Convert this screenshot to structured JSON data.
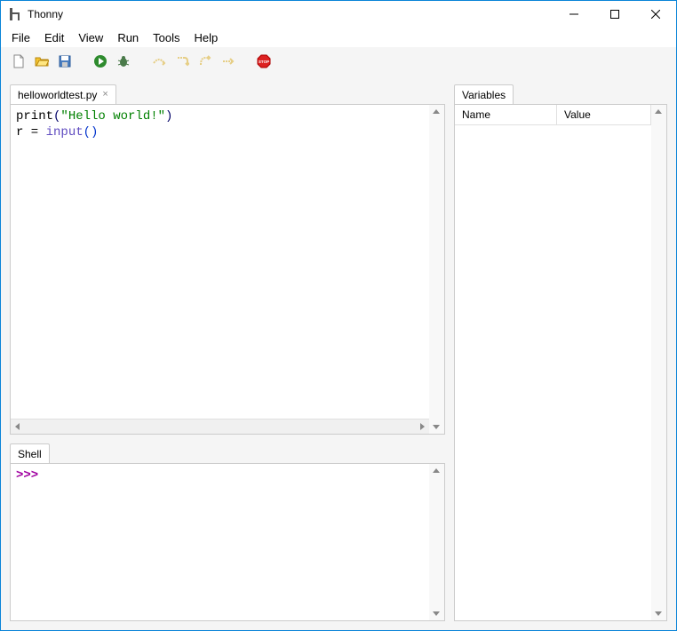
{
  "window": {
    "title": "Thonny"
  },
  "menubar": {
    "items": [
      "File",
      "Edit",
      "View",
      "Run",
      "Tools",
      "Help"
    ]
  },
  "toolbar": {
    "icons": [
      "new-file",
      "open-file",
      "save-file",
      "run",
      "debug",
      "step-over",
      "step-into",
      "step-out",
      "resume",
      "stop"
    ]
  },
  "editor": {
    "tab_label": "helloworldtest.py",
    "code": {
      "line1": {
        "func": "print",
        "lparen": "(",
        "str": "\"Hello world!\"",
        "rparen": ")"
      },
      "line2": {
        "var": "r",
        "eq": " = ",
        "builtin": "input",
        "lparen": "(",
        "rparen": ")"
      }
    }
  },
  "shell": {
    "tab_label": "Shell",
    "prompt": ">>> "
  },
  "variables": {
    "tab_label": "Variables",
    "col_name": "Name",
    "col_value": "Value"
  }
}
